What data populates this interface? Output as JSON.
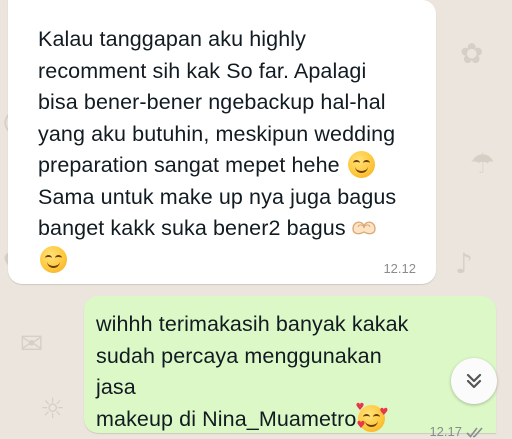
{
  "incoming": {
    "text_lines": [
      "Kalau tanggapan aku highly",
      "recomment sih kak So far. Apalagi",
      "bisa bener-bener ngebackup hal-hal",
      "yang aku butuhin, meskipun wedding",
      "preparation sangat mepet hehe",
      "Sama untuk make up nya juga bagus",
      "banget kakk suka bener2 bagus"
    ],
    "emojis": [
      "smiling-face-emoji",
      "heart-hands-emoji",
      "smiling-face-emoji"
    ],
    "time": "12.12"
  },
  "outgoing": {
    "text_lines": [
      "wihhh terimakasih banyak kakak",
      "sudah percaya menggunakan jasa",
      "makeup di Nina_Muametro"
    ],
    "emojis": [
      "smiling-face-with-hearts-emoji"
    ],
    "time": "12.17",
    "status": "read"
  },
  "scroll_button": {
    "icon": "double-chevron-down-icon"
  },
  "colors": {
    "wallpaper": "#ece5dd",
    "incoming_bubble": "#ffffff",
    "outgoing_bubble": "#dcf8c6",
    "timestamp": "#8a8d8f"
  }
}
